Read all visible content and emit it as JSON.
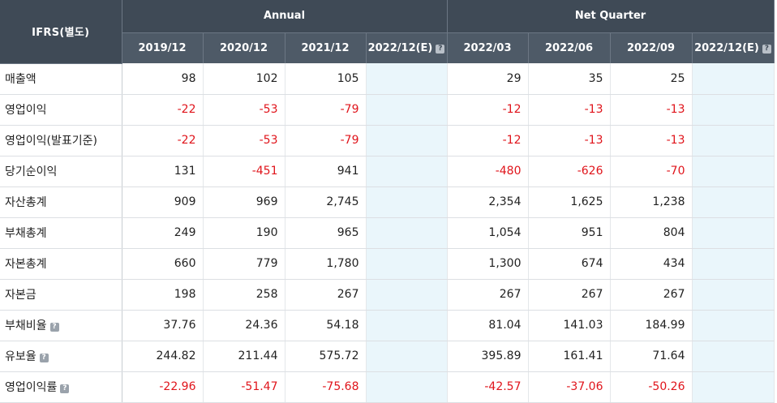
{
  "header": {
    "corner": "IFRS(별도)",
    "group_annual": "Annual",
    "group_quarter": "Net Quarter",
    "help_mark": "?",
    "periods": [
      "2019/12",
      "2020/12",
      "2021/12",
      "2022/12(E)",
      "2022/03",
      "2022/06",
      "2022/09",
      "2022/12(E)"
    ]
  },
  "rows": [
    {
      "label": "매출액",
      "help": false,
      "values": [
        "98",
        "102",
        "105",
        "",
        "29",
        "35",
        "25",
        ""
      ]
    },
    {
      "label": "영업이익",
      "help": false,
      "values": [
        "-22",
        "-53",
        "-79",
        "",
        "-12",
        "-13",
        "-13",
        ""
      ]
    },
    {
      "label": "영업이익(발표기준)",
      "help": false,
      "values": [
        "-22",
        "-53",
        "-79",
        "",
        "-12",
        "-13",
        "-13",
        ""
      ]
    },
    {
      "label": "당기순이익",
      "help": false,
      "values": [
        "131",
        "-451",
        "941",
        "",
        "-480",
        "-626",
        "-70",
        ""
      ]
    },
    {
      "label": "자산총계",
      "help": false,
      "values": [
        "909",
        "969",
        "2,745",
        "",
        "2,354",
        "1,625",
        "1,238",
        ""
      ]
    },
    {
      "label": "부채총계",
      "help": false,
      "values": [
        "249",
        "190",
        "965",
        "",
        "1,054",
        "951",
        "804",
        ""
      ]
    },
    {
      "label": "자본총계",
      "help": false,
      "values": [
        "660",
        "779",
        "1,780",
        "",
        "1,300",
        "674",
        "434",
        ""
      ]
    },
    {
      "label": "자본금",
      "help": false,
      "values": [
        "198",
        "258",
        "267",
        "",
        "267",
        "267",
        "267",
        ""
      ]
    },
    {
      "label": "부채비율",
      "help": true,
      "values": [
        "37.76",
        "24.36",
        "54.18",
        "",
        "81.04",
        "141.03",
        "184.99",
        ""
      ]
    },
    {
      "label": "유보율",
      "help": true,
      "values": [
        "244.82",
        "211.44",
        "575.72",
        "",
        "395.89",
        "161.41",
        "71.64",
        ""
      ]
    },
    {
      "label": "영업이익률",
      "help": true,
      "values": [
        "-22.96",
        "-51.47",
        "-75.68",
        "",
        "-42.57",
        "-37.06",
        "-50.26",
        ""
      ]
    }
  ],
  "colors": {
    "header_dark": "#3f4a56",
    "header_mid": "#4e5a67",
    "negative": "#e0141b",
    "estimate_bg": "#eaf6fb"
  }
}
